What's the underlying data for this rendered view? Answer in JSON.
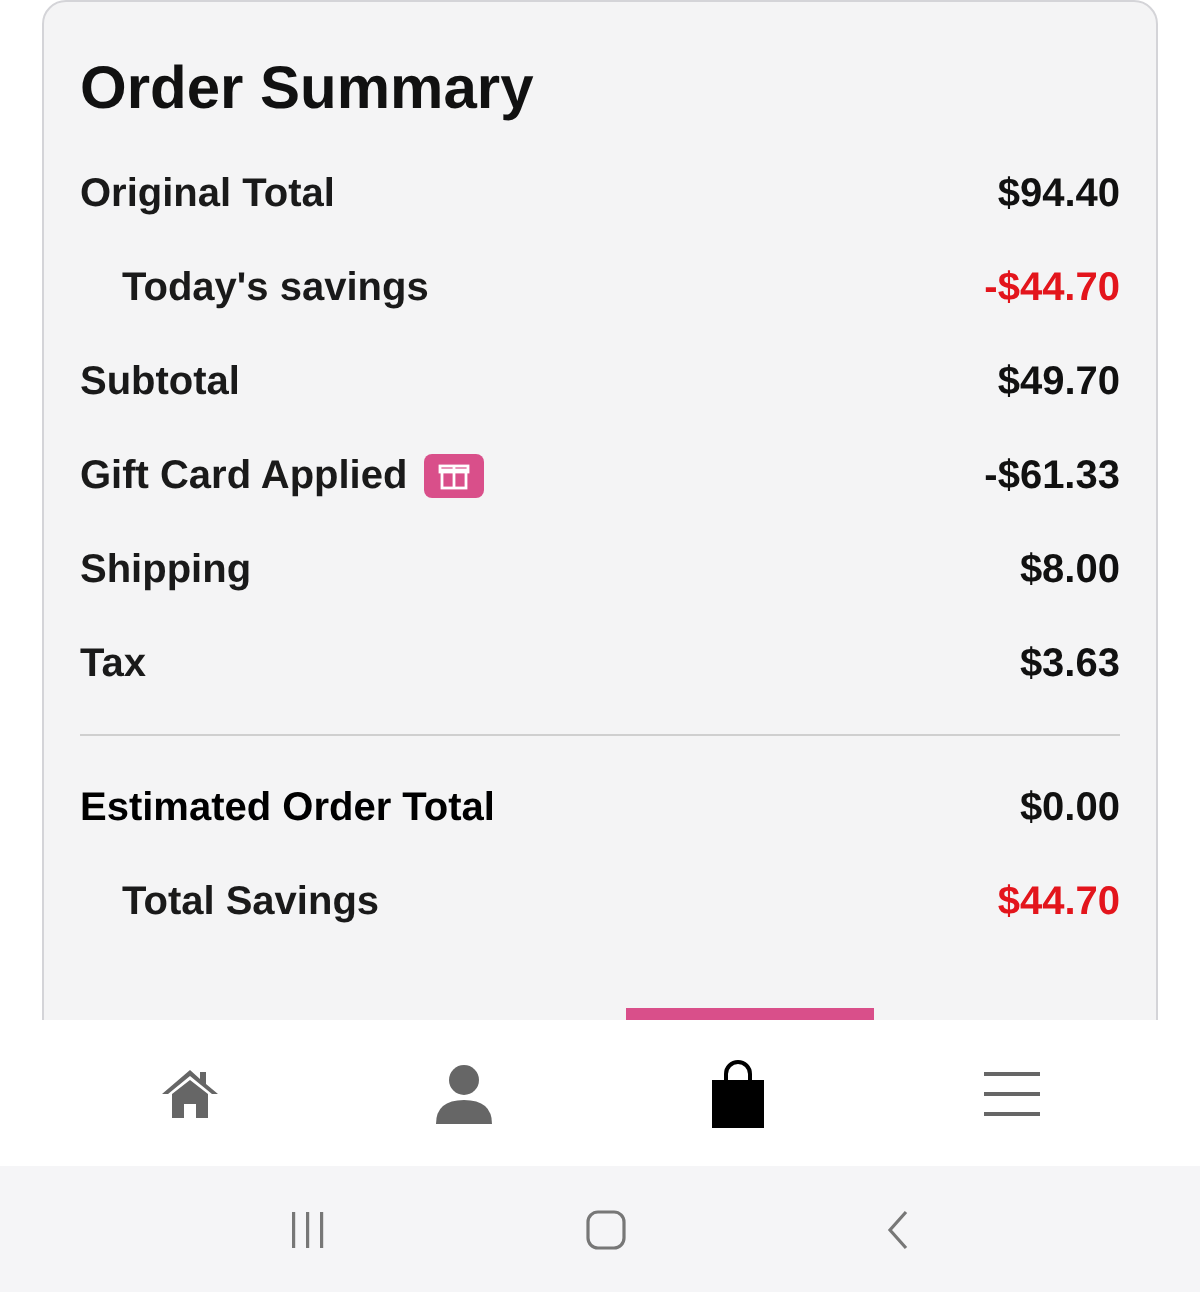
{
  "order_summary": {
    "title": "Order Summary",
    "rows": [
      {
        "kind": "main",
        "label": "Original Total",
        "value": "$94.40",
        "negative": false
      },
      {
        "kind": "sub",
        "label": "Today's savings",
        "value": "-$44.70",
        "negative": true
      },
      {
        "kind": "main",
        "label": "Subtotal",
        "value": "$49.70",
        "negative": false
      },
      {
        "kind": "main",
        "label": "Gift Card Applied",
        "value": "-$61.33",
        "negative": false,
        "badge": {
          "kind": "gift"
        }
      },
      {
        "kind": "main",
        "label": "Shipping",
        "value": "$8.00",
        "negative": false
      },
      {
        "kind": "main",
        "label": "Tax",
        "value": "$3.63",
        "negative": false
      },
      {
        "kind": "divider"
      },
      {
        "kind": "total",
        "label": "Estimated Order Total",
        "value": "$0.00",
        "negative": false
      },
      {
        "kind": "sub",
        "label": "Total Savings",
        "value": "$44.70",
        "negative": true
      }
    ]
  },
  "bottom_nav": [
    {
      "kind": "home",
      "selected": false
    },
    {
      "kind": "account",
      "selected": false
    },
    {
      "kind": "bag",
      "selected": true
    },
    {
      "kind": "menu",
      "selected": false
    }
  ]
}
